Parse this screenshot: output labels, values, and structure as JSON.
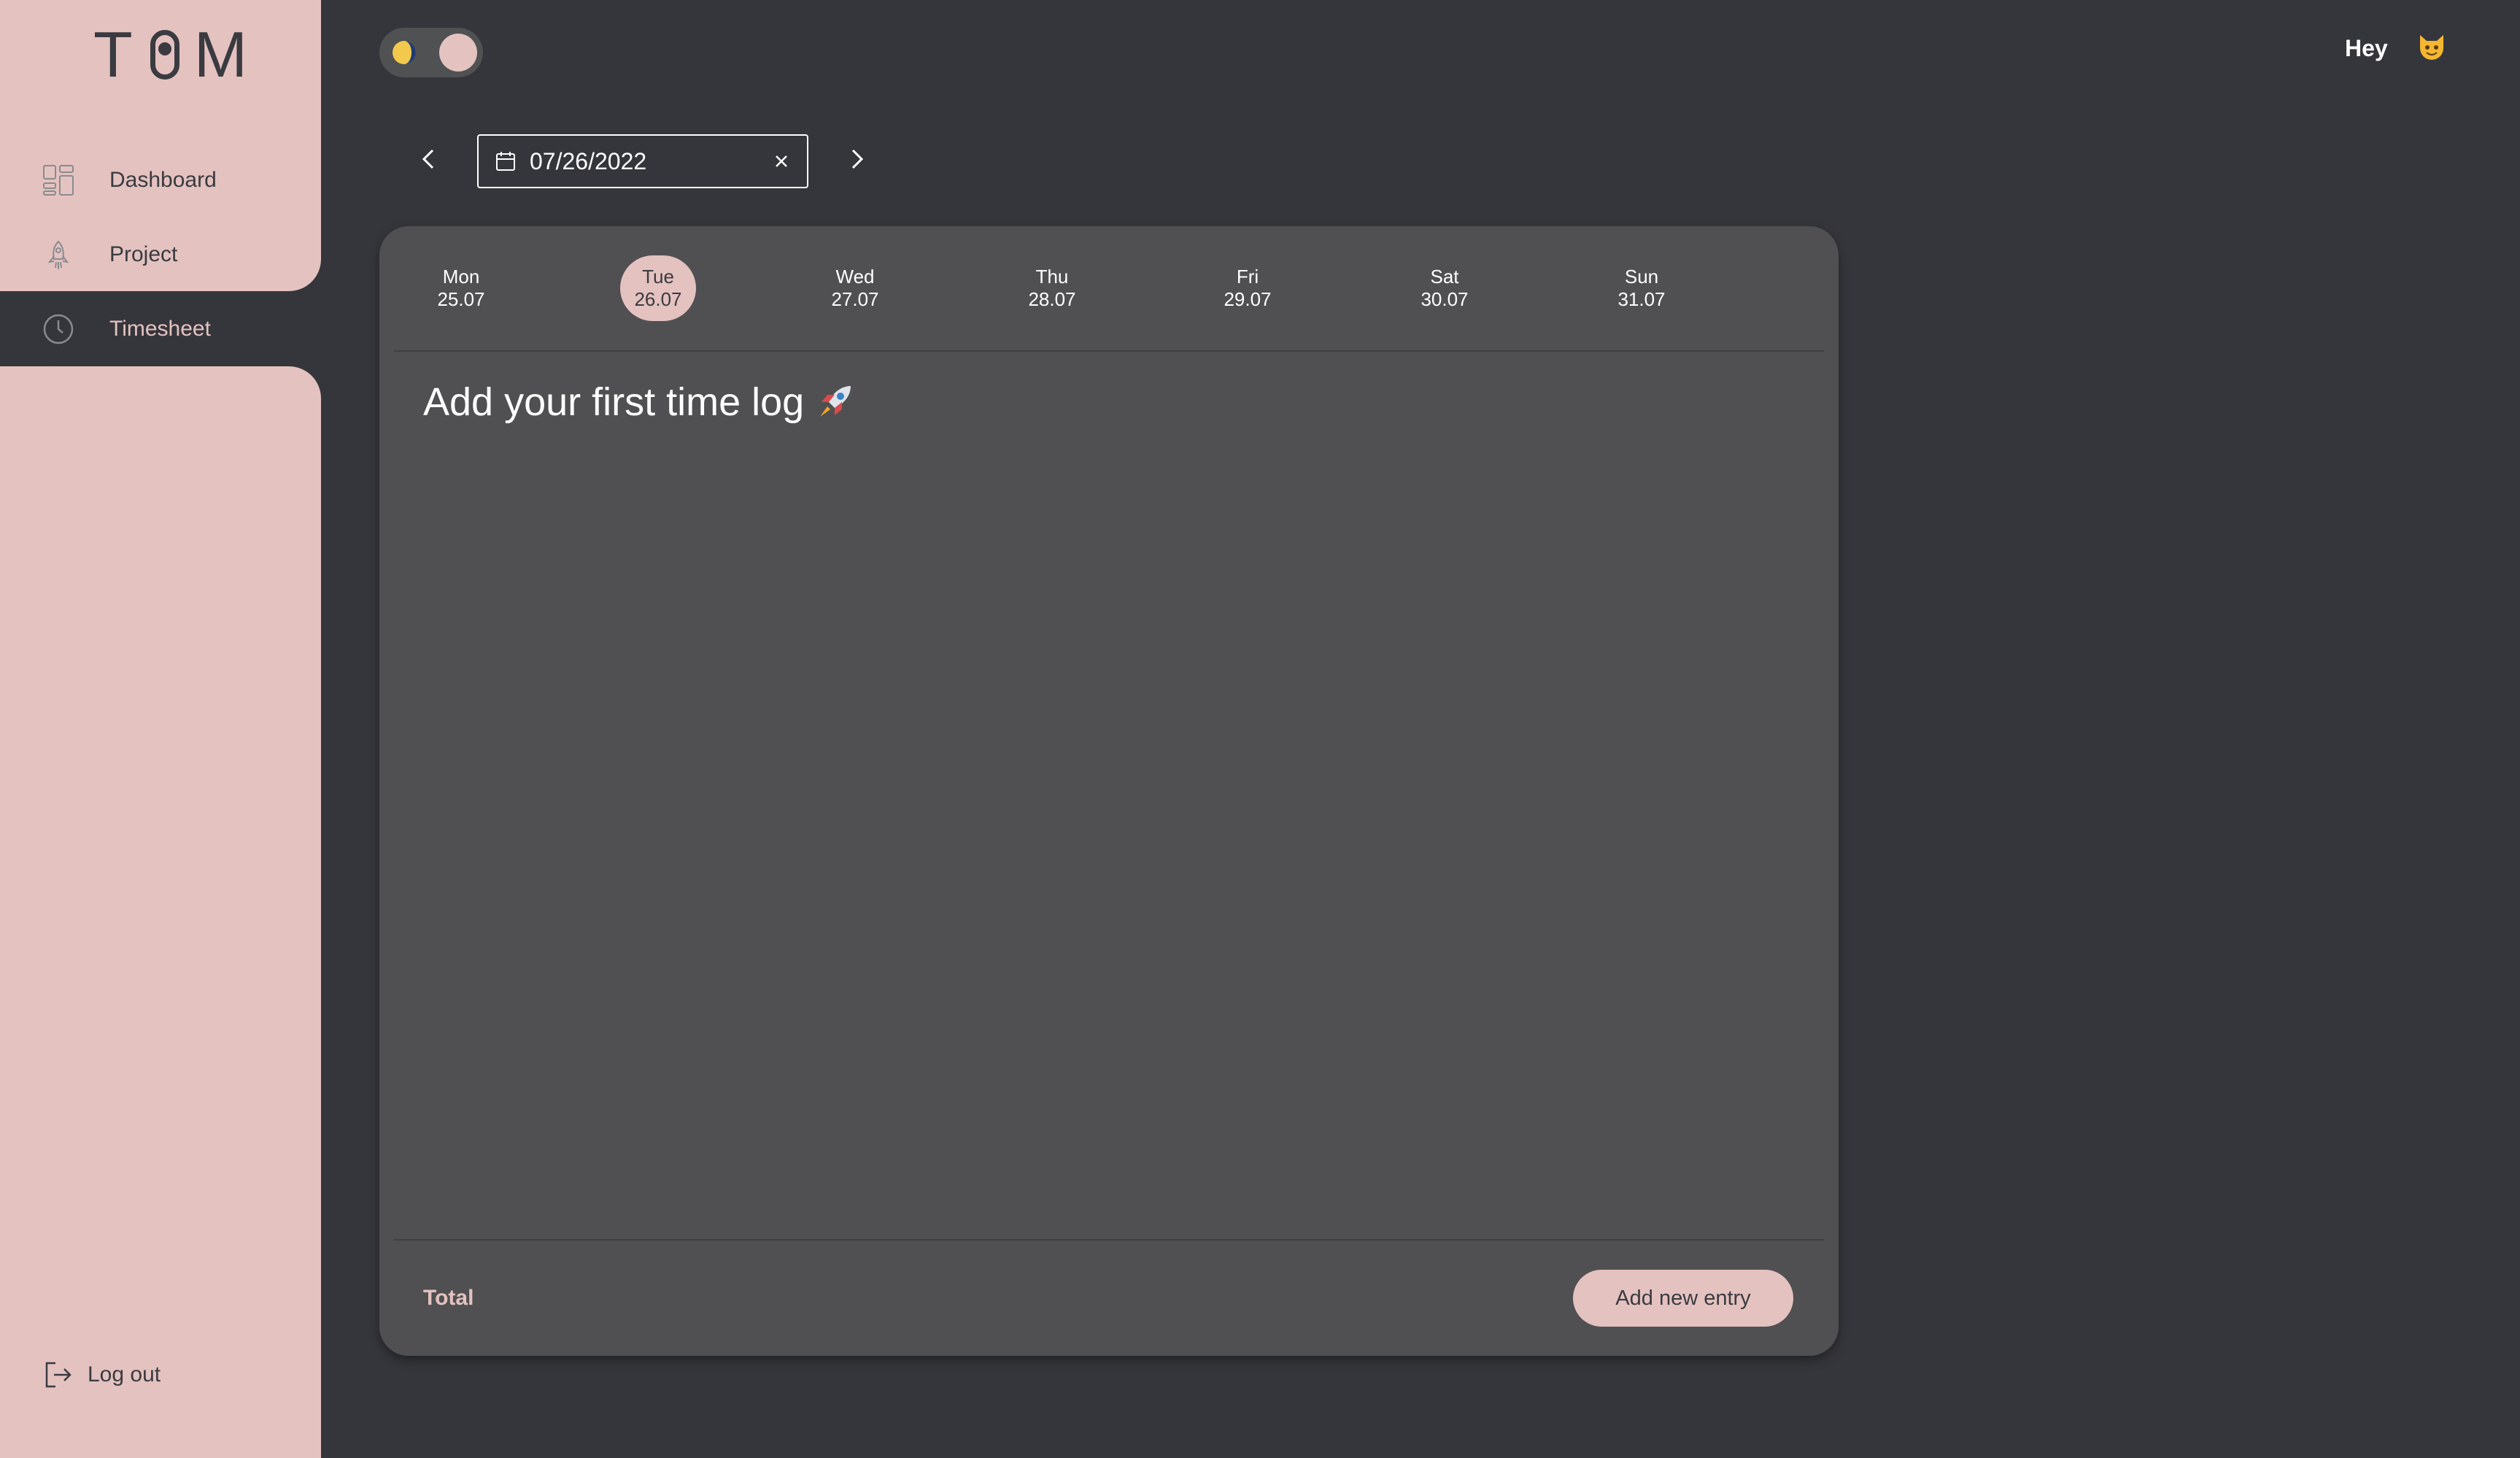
{
  "app": {
    "logo_letters": [
      "T",
      "M"
    ]
  },
  "sidebar": {
    "items": [
      {
        "label": "Dashboard",
        "icon": "dashboard-icon",
        "active": false
      },
      {
        "label": "Project",
        "icon": "rocket-icon",
        "active": false
      },
      {
        "label": "Timesheet",
        "icon": "clock-icon",
        "active": true
      }
    ],
    "logout_label": "Log out"
  },
  "header": {
    "theme_toggle": "dark-mode-toggle",
    "greeting": "Hey",
    "avatar_icon": "cat-face-icon"
  },
  "date_picker": {
    "value": "07/26/2022",
    "icons": [
      "calendar-icon",
      "close-icon",
      "chevron-left-icon",
      "chevron-right-icon"
    ]
  },
  "week": {
    "days": [
      {
        "name": "Mon",
        "date": "25.07"
      },
      {
        "name": "Tue",
        "date": "26.07",
        "selected": true
      },
      {
        "name": "Wed",
        "date": "27.07"
      },
      {
        "name": "Thu",
        "date": "28.07"
      },
      {
        "name": "Fri",
        "date": "29.07"
      },
      {
        "name": "Sat",
        "date": "30.07"
      },
      {
        "name": "Sun",
        "date": "31.07"
      }
    ]
  },
  "timelog": {
    "empty_message": "Add your first time log",
    "empty_icon": "rocket-emoji-icon",
    "total_label": "Total",
    "add_button_label": "Add new entry"
  },
  "colors": {
    "background": "#35363b",
    "sidebar": "#e4c2c0",
    "card": "#505052",
    "accent": "#e4c2c0",
    "text_light": "#ffffff",
    "text_dark": "#3a3b40"
  }
}
